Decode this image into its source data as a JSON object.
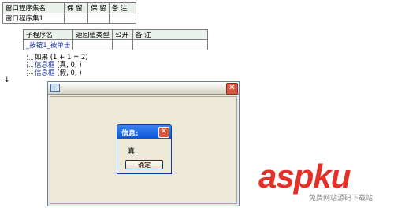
{
  "window_table": {
    "headers": [
      "窗口程序集名",
      "保 留",
      "保 留",
      "备 注"
    ],
    "row": [
      "窗口程序集1",
      "",
      "",
      ""
    ]
  },
  "sub_table": {
    "headers": [
      "子程序名",
      "返回值类型",
      "公开",
      "备 注"
    ],
    "row": [
      "_按钮1_被单击",
      "",
      "",
      ""
    ]
  },
  "code_lines": [
    {
      "keyword": "如果",
      "args": "(1 + 1 = 2)"
    },
    {
      "keyword": "信息框",
      "args": "(真, 0, )"
    },
    {
      "keyword": "信息框",
      "args": "(假, 0, )"
    }
  ],
  "form_window": {
    "close_glyph": "✕"
  },
  "message_box": {
    "title": "信息:",
    "text": "真",
    "ok_label": "确定",
    "close_glyph": "✕"
  },
  "watermark": {
    "logo_text": "aspku",
    "subtitle": "免费网站源码下载站"
  },
  "colors": {
    "title_blue": "#0a54d8",
    "close_red": "#d8563e",
    "watermark_red": "#e5302a",
    "keyword_blue": "#1a2fa8"
  }
}
